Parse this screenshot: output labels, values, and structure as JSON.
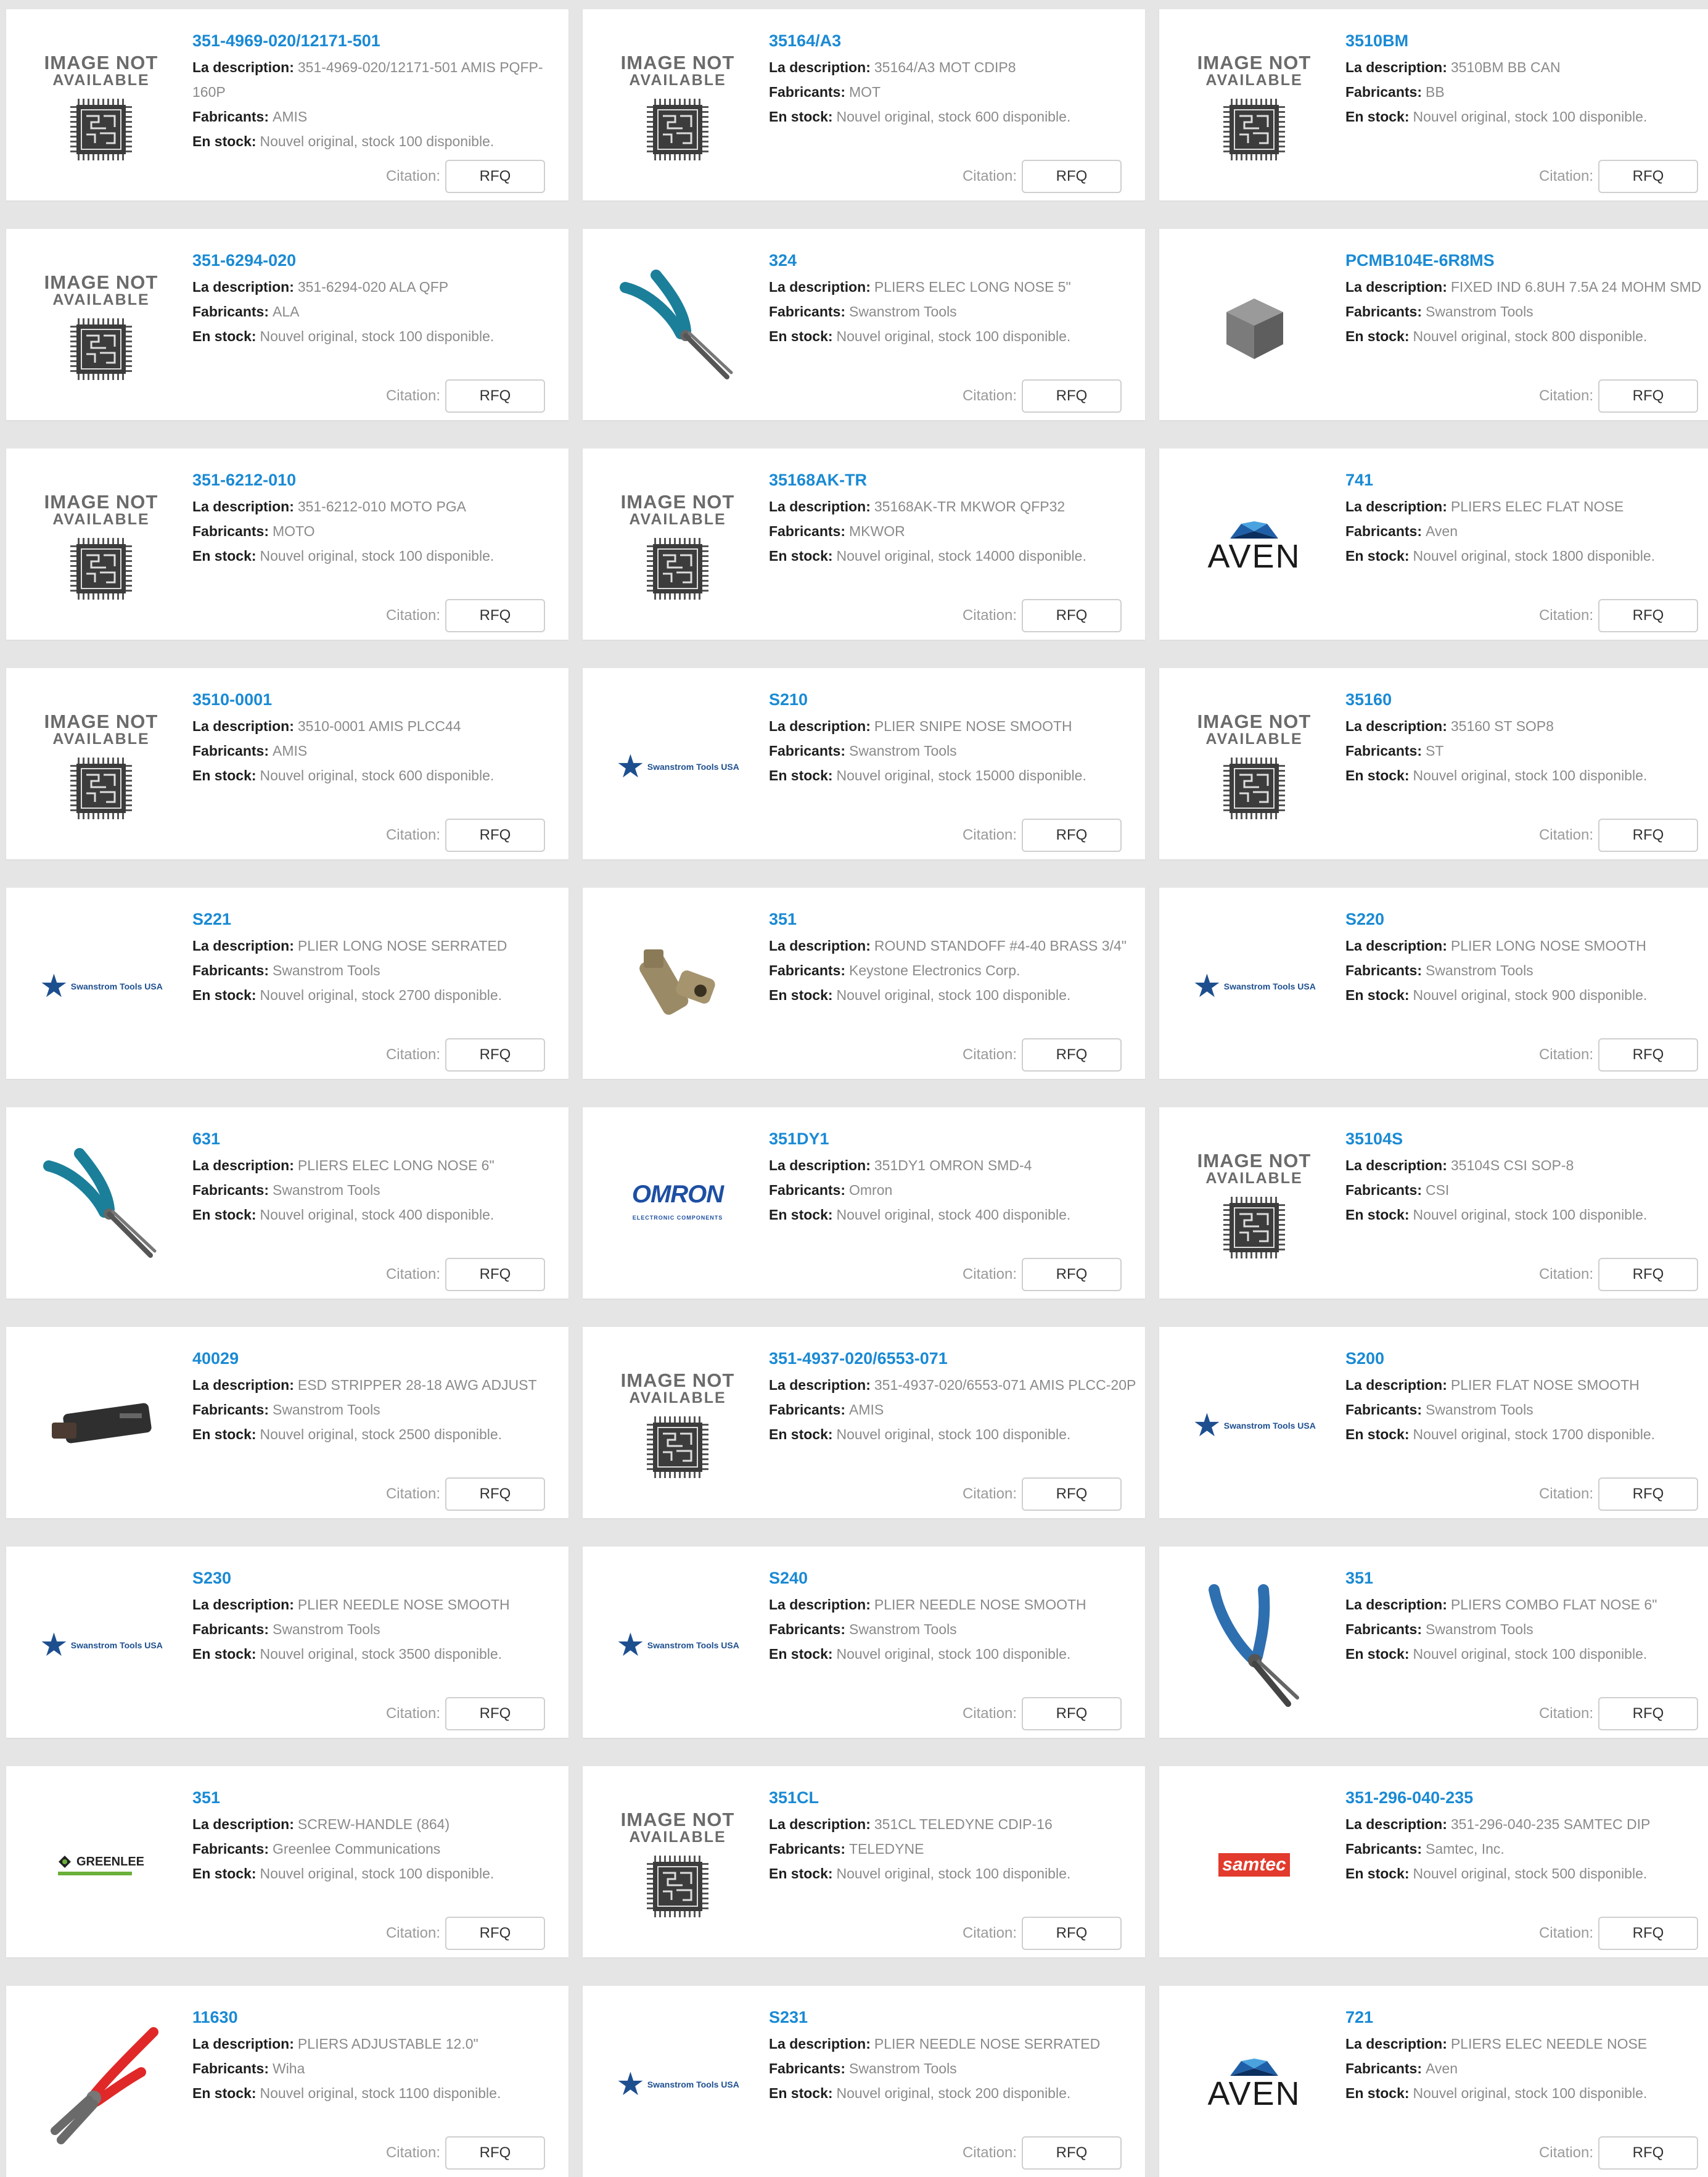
{
  "labels": {
    "description": "La description:",
    "manufacturer": "Fabricants:",
    "stock": "En stock:",
    "quote": "Citation:",
    "rfq": "RFQ"
  },
  "image_placeholder": {
    "line1": "IMAGE NOT",
    "line2": "AVAILABLE"
  },
  "products": [
    {
      "part": "351-4969-020/12171-501",
      "description": "351-4969-020/12171-501 AMIS PQFP-160P",
      "manufacturer": "AMIS",
      "stock": "Nouvel original, stock 100 disponible.",
      "image": "not-available"
    },
    {
      "part": "35164/A3",
      "description": "35164/A3 MOT CDIP8",
      "manufacturer": "MOT",
      "stock": "Nouvel original, stock 600 disponible.",
      "image": "not-available"
    },
    {
      "part": "3510BM",
      "description": "3510BM BB CAN",
      "manufacturer": "BB",
      "stock": "Nouvel original, stock 100 disponible.",
      "image": "not-available"
    },
    {
      "part": "351-6294-020",
      "description": "351-6294-020 ALA QFP",
      "manufacturer": "ALA",
      "stock": "Nouvel original, stock 100 disponible.",
      "image": "not-available"
    },
    {
      "part": "324",
      "description": "PLIERS ELEC LONG NOSE 5\"",
      "manufacturer": "Swanstrom Tools",
      "stock": "Nouvel original, stock 100 disponible.",
      "image": "pliers-blue"
    },
    {
      "part": "PCMB104E-6R8MS",
      "description": "FIXED IND 6.8UH 7.5A 24 MOHM SMD",
      "manufacturer": "Swanstrom Tools",
      "stock": "Nouvel original, stock 800 disponible.",
      "image": "inductor"
    },
    {
      "part": "351-6212-010",
      "description": "351-6212-010 MOTO PGA",
      "manufacturer": "MOTO",
      "stock": "Nouvel original, stock 100 disponible.",
      "image": "not-available"
    },
    {
      "part": "35168AK-TR",
      "description": "35168AK-TR MKWOR QFP32",
      "manufacturer": "MKWOR",
      "stock": "Nouvel original, stock 14000 disponible.",
      "image": "not-available"
    },
    {
      "part": "741",
      "description": "PLIERS ELEC FLAT NOSE",
      "manufacturer": "Aven",
      "stock": "Nouvel original, stock 1800 disponible.",
      "image": "aven"
    },
    {
      "part": "3510-0001",
      "description": "3510-0001 AMIS PLCC44",
      "manufacturer": "AMIS",
      "stock": "Nouvel original, stock 600 disponible.",
      "image": "not-available"
    },
    {
      "part": "S210",
      "description": "PLIER SNIPE NOSE SMOOTH",
      "manufacturer": "Swanstrom Tools",
      "stock": "Nouvel original, stock 15000 disponible.",
      "image": "swanstrom"
    },
    {
      "part": "35160",
      "description": "35160 ST SOP8",
      "manufacturer": "ST",
      "stock": "Nouvel original, stock 100 disponible.",
      "image": "not-available"
    },
    {
      "part": "S221",
      "description": "PLIER LONG NOSE SERRATED",
      "manufacturer": "Swanstrom Tools",
      "stock": "Nouvel original, stock 2700 disponible.",
      "image": "swanstrom"
    },
    {
      "part": "351",
      "description": "ROUND STANDOFF #4-40 BRASS 3/4\"",
      "manufacturer": "Keystone Electronics Corp.",
      "stock": "Nouvel original, stock 100 disponible.",
      "image": "standoff"
    },
    {
      "part": "S220",
      "description": "PLIER LONG NOSE SMOOTH",
      "manufacturer": "Swanstrom Tools",
      "stock": "Nouvel original, stock 900 disponible.",
      "image": "swanstrom"
    },
    {
      "part": "631",
      "description": "PLIERS ELEC LONG NOSE 6\"",
      "manufacturer": "Swanstrom Tools",
      "stock": "Nouvel original, stock 400 disponible.",
      "image": "pliers-blue"
    },
    {
      "part": "351DY1",
      "description": "351DY1 OMRON SMD-4",
      "manufacturer": "Omron",
      "stock": "Nouvel original, stock 400 disponible.",
      "image": "omron"
    },
    {
      "part": "35104S",
      "description": "35104S CSI SOP-8",
      "manufacturer": "CSI",
      "stock": "Nouvel original, stock 100 disponible.",
      "image": "not-available"
    },
    {
      "part": "40029",
      "description": "ESD STRIPPER 28-18 AWG ADJUST",
      "manufacturer": "Swanstrom Tools",
      "stock": "Nouvel original, stock 2500 disponible.",
      "image": "stripper"
    },
    {
      "part": "351-4937-020/6553-071",
      "description": "351-4937-020/6553-071 AMIS PLCC-20P",
      "manufacturer": "AMIS",
      "stock": "Nouvel original, stock 100 disponible.",
      "image": "not-available"
    },
    {
      "part": "S200",
      "description": "PLIER FLAT NOSE SMOOTH",
      "manufacturer": "Swanstrom Tools",
      "stock": "Nouvel original, stock 1700 disponible.",
      "image": "swanstrom"
    },
    {
      "part": "S230",
      "description": "PLIER NEEDLE NOSE SMOOTH",
      "manufacturer": "Swanstrom Tools",
      "stock": "Nouvel original, stock 3500 disponible.",
      "image": "swanstrom"
    },
    {
      "part": "S240",
      "description": "PLIER NEEDLE NOSE SMOOTH",
      "manufacturer": "Swanstrom Tools",
      "stock": "Nouvel original, stock 100 disponible.",
      "image": "swanstrom"
    },
    {
      "part": "351",
      "description": "PLIERS COMBO FLAT NOSE 6\"",
      "manufacturer": "Swanstrom Tools",
      "stock": "Nouvel original, stock 100 disponible.",
      "image": "pliers-blue-vertical"
    },
    {
      "part": "351",
      "description": "SCREW-HANDLE (864)",
      "manufacturer": "Greenlee Communications",
      "stock": "Nouvel original, stock 100 disponible.",
      "image": "greenlee"
    },
    {
      "part": "351CL",
      "description": "351CL TELEDYNE CDIP-16",
      "manufacturer": "TELEDYNE",
      "stock": "Nouvel original, stock 100 disponible.",
      "image": "not-available"
    },
    {
      "part": "351-296-040-235",
      "description": "351-296-040-235 SAMTEC DIP",
      "manufacturer": "Samtec, Inc.",
      "stock": "Nouvel original, stock 500 disponible.",
      "image": "samtec"
    },
    {
      "part": "11630",
      "description": "PLIERS ADJUSTABLE 12.0\"",
      "manufacturer": "Wiha",
      "stock": "Nouvel original, stock 1100 disponible.",
      "image": "pliers-red"
    },
    {
      "part": "S231",
      "description": "PLIER NEEDLE NOSE SERRATED",
      "manufacturer": "Swanstrom Tools",
      "stock": "Nouvel original, stock 200 disponible.",
      "image": "swanstrom"
    },
    {
      "part": "721",
      "description": "PLIERS ELEC NEEDLE NOSE",
      "manufacturer": "Aven",
      "stock": "Nouvel original, stock 100 disponible.",
      "image": "aven"
    }
  ],
  "logos": {
    "swanstrom": "Swanstrom Tools USA",
    "aven": "AVEN",
    "omron": "OMRON",
    "omron_sub": "ELECTRONIC COMPONENTS",
    "samtec": "samtec",
    "greenlee": "GREENLEE"
  },
  "colors": {
    "link": "#1a8ad4",
    "background": "#e5e5e5",
    "card": "#ffffff"
  }
}
